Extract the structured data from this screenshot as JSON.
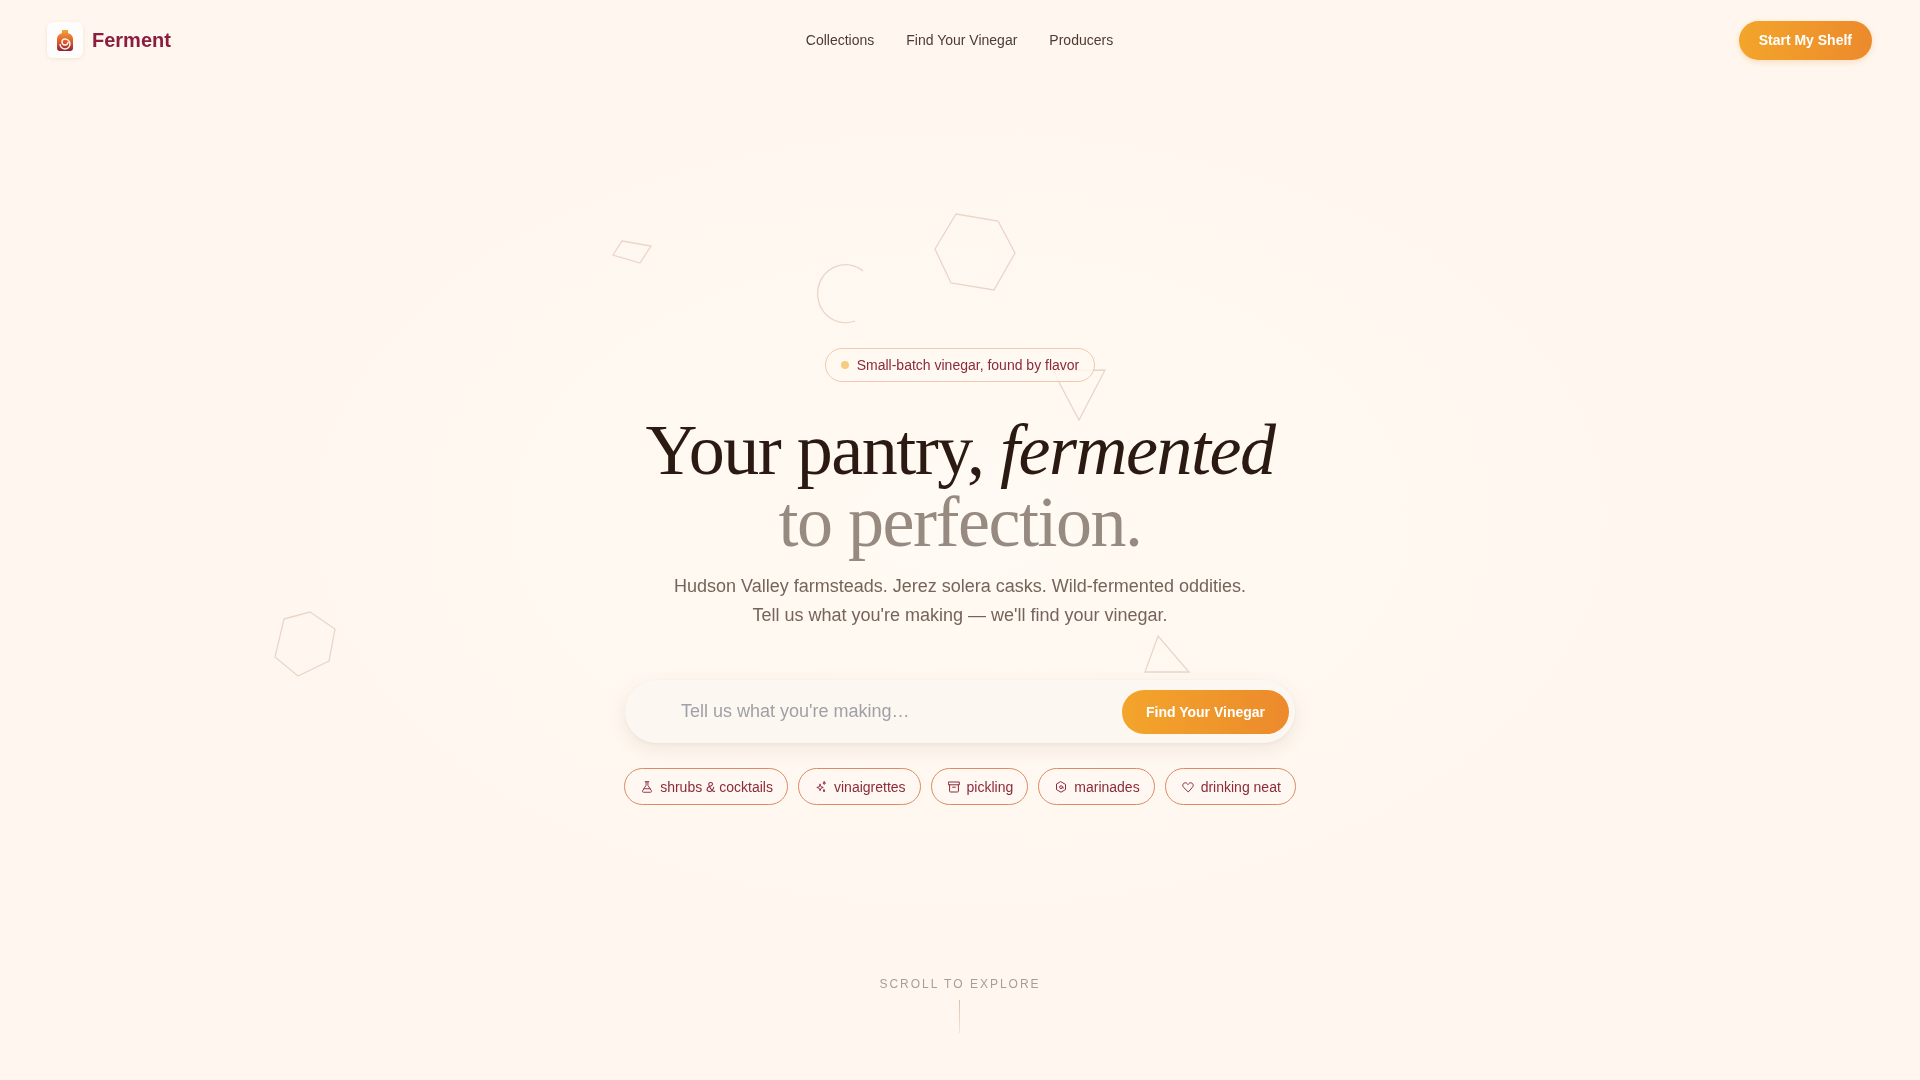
{
  "brand": {
    "name": "Ferment"
  },
  "nav": {
    "links": [
      "Collections",
      "Find Your Vinegar",
      "Producers"
    ],
    "cta": "Start My Shelf"
  },
  "hero": {
    "badge": "Small-batch vinegar, found by flavor",
    "headline": {
      "line_1": "Your pantry, *fermented*",
      "line_2": "to perfection."
    },
    "subtitle": "Hudson Valley farmsteads. Jerez solera casks. Wild-fermented oddities. Tell us what you're making — we'll find your vinegar."
  },
  "search": {
    "placeholder": "Tell us what you're making…",
    "button": "Find Your Vinegar"
  },
  "chips": [
    "shrubs & cocktails",
    "vinaigrettes",
    "pickling",
    "marinades",
    "drinking neat"
  ],
  "scroll_hint": "SCROLL TO EXPLORE"
}
